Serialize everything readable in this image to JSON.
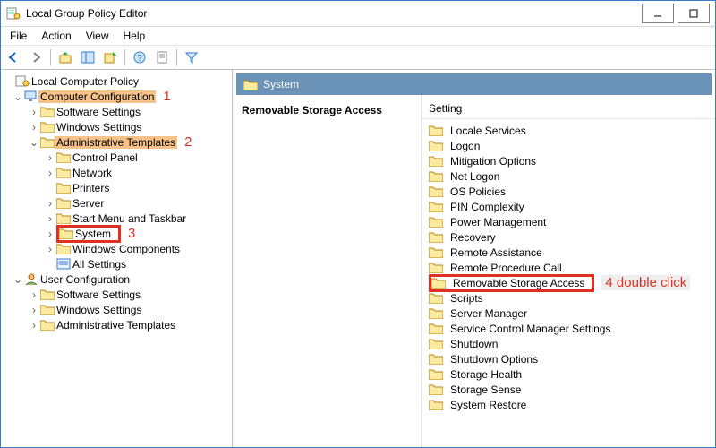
{
  "title": "Local Group Policy Editor",
  "menu": [
    "File",
    "Action",
    "View",
    "Help"
  ],
  "path": "System",
  "selected": "Removable Storage Access",
  "colHeader": "Setting",
  "anno": {
    "a1": "1",
    "a2": "2",
    "a3": "3",
    "a4": "4 double click"
  },
  "tree": {
    "root": "Local Computer Policy",
    "cc": "Computer Configuration",
    "ss": "Software Settings",
    "ws": "Windows Settings",
    "at": "Administrative Templates",
    "cp": "Control Panel",
    "net": "Network",
    "prn": "Printers",
    "srv": "Server",
    "smt": "Start Menu and Taskbar",
    "sys": "System",
    "wc": "Windows Components",
    "all": "All Settings",
    "uc": "User Configuration"
  },
  "items": [
    "Locale Services",
    "Logon",
    "Mitigation Options",
    "Net Logon",
    "OS Policies",
    "PIN Complexity",
    "Power Management",
    "Recovery",
    "Remote Assistance",
    "Remote Procedure Call",
    "Removable Storage Access",
    "Scripts",
    "Server Manager",
    "Service Control Manager Settings",
    "Shutdown",
    "Shutdown Options",
    "Storage Health",
    "Storage Sense",
    "System Restore"
  ],
  "highlightIndex": 10
}
